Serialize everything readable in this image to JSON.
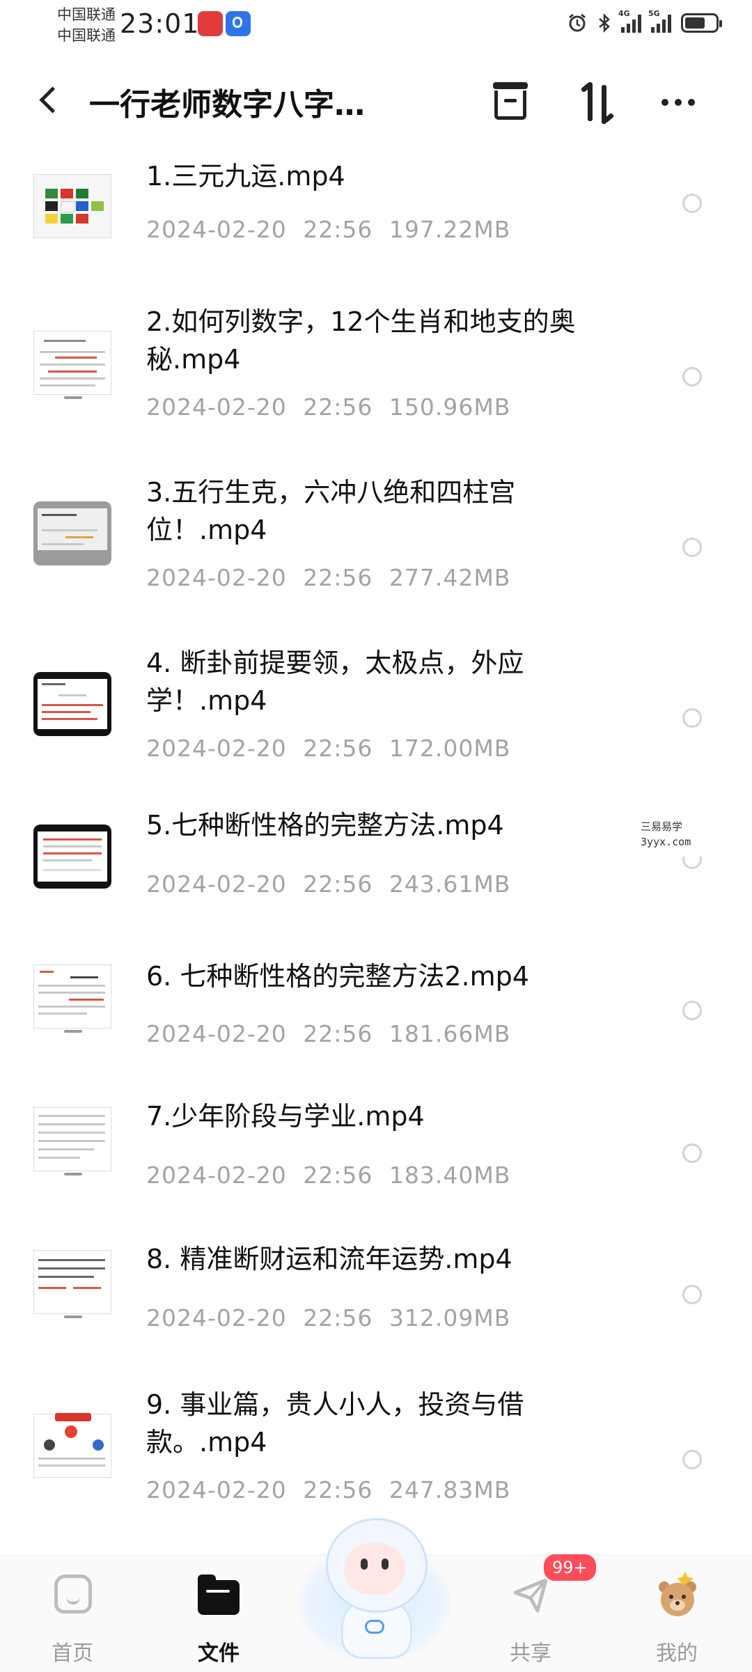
{
  "status_bar": {
    "carrier_1": "中国联通",
    "carrier_2": "中国联通",
    "time": "23:01",
    "network_1": "4G",
    "network_2": "5G"
  },
  "header": {
    "title": "一行老师数字八字…"
  },
  "files": [
    {
      "name": "1.三元九运.mp4",
      "meta": "2024-02-20 22:56 197.22MB"
    },
    {
      "name": "2.如何列数字，12个生肖和地支的奥秘.mp4",
      "meta": "2024-02-20 22:56 150.96MB"
    },
    {
      "name": "3.五行生克，六冲八绝和四柱宫位！.mp4",
      "meta": "2024-02-20 22:56 277.42MB"
    },
    {
      "name": "4. 断卦前提要领，太极点，外应学！.mp4",
      "meta": "2024-02-20 22:56 172.00MB"
    },
    {
      "name": "5.七种断性格的完整方法.mp4",
      "meta": "2024-02-20 22:56 243.61MB"
    },
    {
      "name": "6. 七种断性格的完整方法2.mp4",
      "meta": "2024-02-20 22:56 181.66MB"
    },
    {
      "name": "7.少年阶段与学业.mp4",
      "meta": "2024-02-20 22:56 183.40MB"
    },
    {
      "name": "8. 精准断财运和流年运势.mp4",
      "meta": "2024-02-20 22:56 312.09MB"
    },
    {
      "name": "9. 事业篇，贵人小人，投资与借款。.mp4",
      "meta": "2024-02-20 22:56 247.83MB"
    }
  ],
  "watermark": {
    "line1": "三易易学",
    "line2": "3yyx.com"
  },
  "nav": {
    "home": "首页",
    "files": "文件",
    "share": "共享",
    "share_badge": "99+",
    "mine": "我的"
  },
  "colors": {
    "accent": "#111111",
    "meta": "#a3a3a3",
    "badge": "#ff4d5a"
  }
}
